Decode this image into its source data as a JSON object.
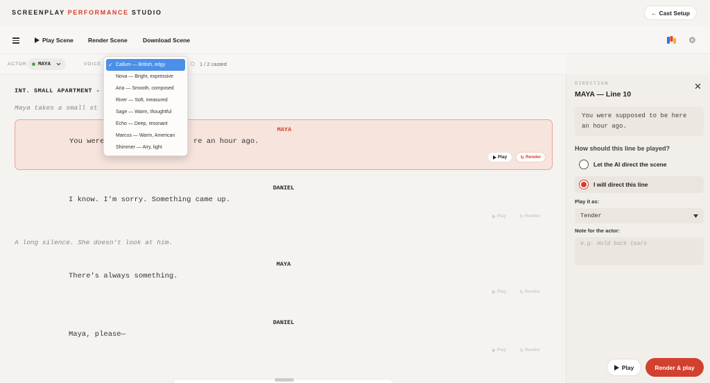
{
  "brand": {
    "part1": "SCREENPLAY ",
    "part2": "PERFORMANCE",
    "part3": " STUDIO"
  },
  "header": {
    "cast_setup": "Cast Setup",
    "cast_setup_arrow": "←"
  },
  "toolbar": {
    "play_scene": "Play Scene",
    "render_scene": "Render Scene",
    "download_scene": "Download Scene"
  },
  "actor_row": {
    "actor_label": "ACTOR",
    "actor_value": "MAYA",
    "voice_label": "VOICE",
    "casted": "1 / 2 casted"
  },
  "voice_options": [
    {
      "label": "Callum — British, edgy",
      "selected": true
    },
    {
      "label": "Nova — Bright, expressive"
    },
    {
      "label": "Aria — Smooth, composed"
    },
    {
      "label": "River — Soft, measured"
    },
    {
      "label": "Sage — Warm, thoughtful"
    },
    {
      "label": "Echo — Deep, resonant"
    },
    {
      "label": "Marcus — Warm, American"
    },
    {
      "label": "Shimmer — Airy, light"
    }
  ],
  "script": {
    "scene_heading": "INT. SMALL APARTMENT -",
    "action1": "Maya takes a small st",
    "lines": [
      {
        "character": "MAYA",
        "dialogue": "You were supposed to be here an hour ago.",
        "play": "Play",
        "render": "Render"
      },
      {
        "character": "DANIEL",
        "dialogue": "I know. I'm sorry. Something came up.",
        "play": "Play",
        "render": "Render"
      },
      {
        "character": "MAYA",
        "dialogue": "There's always something.",
        "play": "Play",
        "render": "Render"
      },
      {
        "character": "DANIEL",
        "dialogue": "Maya, please—",
        "play": "Play",
        "render": "Render"
      }
    ],
    "dialogue_visible_start": "You were",
    "dialogue_visible_end": "re an hour ago.",
    "action2": "A long silence. She doesn't look at him."
  },
  "panel": {
    "direction_label": "DIRECTION",
    "title": "MAYA — Line 10",
    "quote": "You were supposed to be here an hour ago.",
    "question": "How should this line be played?",
    "option_ai": "Let the AI direct the scene",
    "option_me": "I will direct this line",
    "selected_option": "option_me",
    "play_as_label": "Play it as:",
    "play_as_value": "Tender",
    "note_label": "Note for the actor:",
    "note_placeholder": "e.g. Hold back tears",
    "play_button": "Play",
    "render_button": "Render & play"
  },
  "colors": {
    "accent": "#d2402f",
    "actor_dot": "#4aa35b",
    "dropdown_selected": "#4a90e8"
  },
  "icons": [
    "hamburger-icon",
    "play-icon",
    "refresh-icon",
    "close-icon",
    "chevron-down-icon",
    "gear-icon",
    "arrow-left-icon",
    "check-icon"
  ]
}
